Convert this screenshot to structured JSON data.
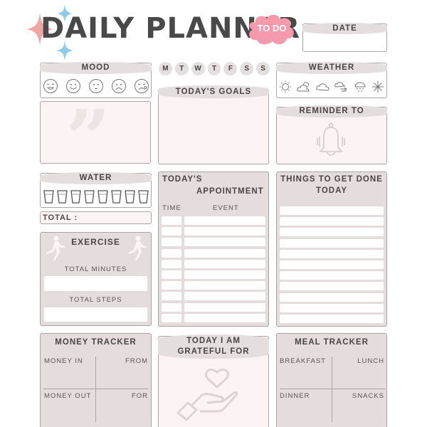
{
  "header": {
    "title": "DAILY PLANNER",
    "todo_badge": "TO DO",
    "date_label": "DATE",
    "colors": {
      "todo_pink": "#f49aac",
      "sparkle_blue": "#8fcbed",
      "sparkle_pink": "#f1a6a6"
    }
  },
  "mood": {
    "label": "MOOD",
    "icons": [
      "laughing-face-icon",
      "smiling-face-icon",
      "neutral-face-icon",
      "sad-face-icon",
      "crying-face-icon"
    ]
  },
  "days": [
    "M",
    "T",
    "W",
    "T",
    "F",
    "S",
    "S"
  ],
  "weather": {
    "label": "WEATHER",
    "icons": [
      "sun-icon",
      "partly-cloudy-icon",
      "cloudy-icon",
      "windy-icon",
      "rain-snow-icon",
      "snowflake-icon"
    ]
  },
  "goals": {
    "label": "TODAY'S GOALS"
  },
  "quote": {
    "icon": "quote-icon"
  },
  "reminder": {
    "label": "REMINDER TO",
    "icon": "bell-icon"
  },
  "water": {
    "label": "WATER",
    "glass_count": 8,
    "total_label": "TOTAL :"
  },
  "exercise": {
    "label": "EXERCISE",
    "minutes_label": "TOTAL MINUTES",
    "steps_label": "TOTAL STEPS"
  },
  "appointment": {
    "label_line1": "TODAY'S",
    "label_line2": "APPOINTMENT",
    "time_col": "TIME",
    "event_col": "EVENT",
    "row_count": 10
  },
  "todo_list": {
    "label_line1": "THINGS TO GET DONE",
    "label_line2": "TODAY",
    "row_count": 11
  },
  "money": {
    "label": "MONEY TRACKER",
    "in": "MONEY IN",
    "from": "FROM",
    "out": "MONEY OUT",
    "for": "FOR"
  },
  "grateful": {
    "label_line1": "TODAY I AM",
    "label_line2": "GRATEFUL FOR",
    "icon": "heart-hand-icon"
  },
  "meal": {
    "label": "MEAL TRACKER",
    "breakfast": "BREAKFAST",
    "lunch": "LUNCH",
    "dinner": "DINNER",
    "snacks": "SNACKS"
  }
}
